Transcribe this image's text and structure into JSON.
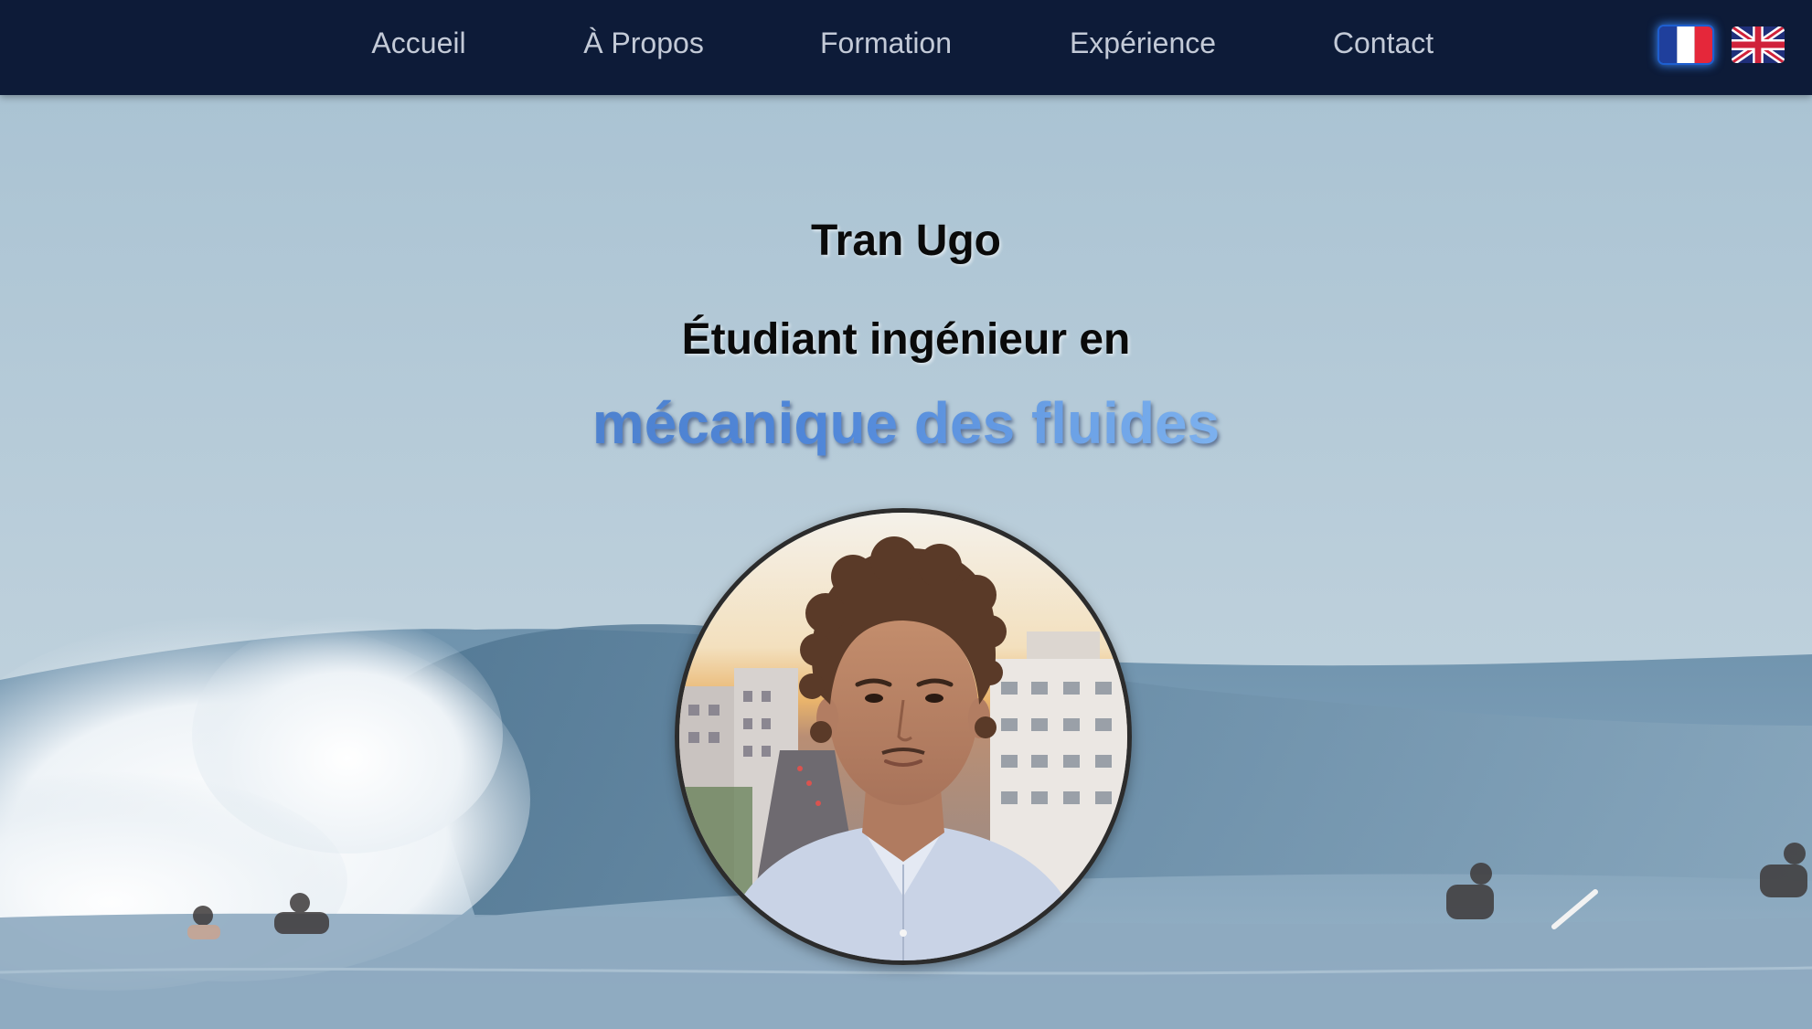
{
  "nav": {
    "links": [
      {
        "label": "Accueil"
      },
      {
        "label": "À Propos"
      },
      {
        "label": "Formation"
      },
      {
        "label": "Expérience"
      },
      {
        "label": "Contact"
      }
    ],
    "languages": [
      {
        "code": "fr",
        "icon": "france-flag-icon",
        "active": true
      },
      {
        "code": "en",
        "icon": "uk-flag-icon",
        "active": false
      }
    ]
  },
  "hero": {
    "name": "Tran Ugo",
    "subtitle": "Étudiant ingénieur en",
    "field": "mécanique des fluides",
    "background": "ocean-wave-surfers-image",
    "avatar": "profile-photo"
  },
  "colors": {
    "navbar": "#0d1b38",
    "nav_text": "#c3cad7",
    "field_gradient_start": "#4d78b8",
    "field_gradient_end": "#8cc0f6",
    "active_flag_glow": "#3c8cff"
  }
}
